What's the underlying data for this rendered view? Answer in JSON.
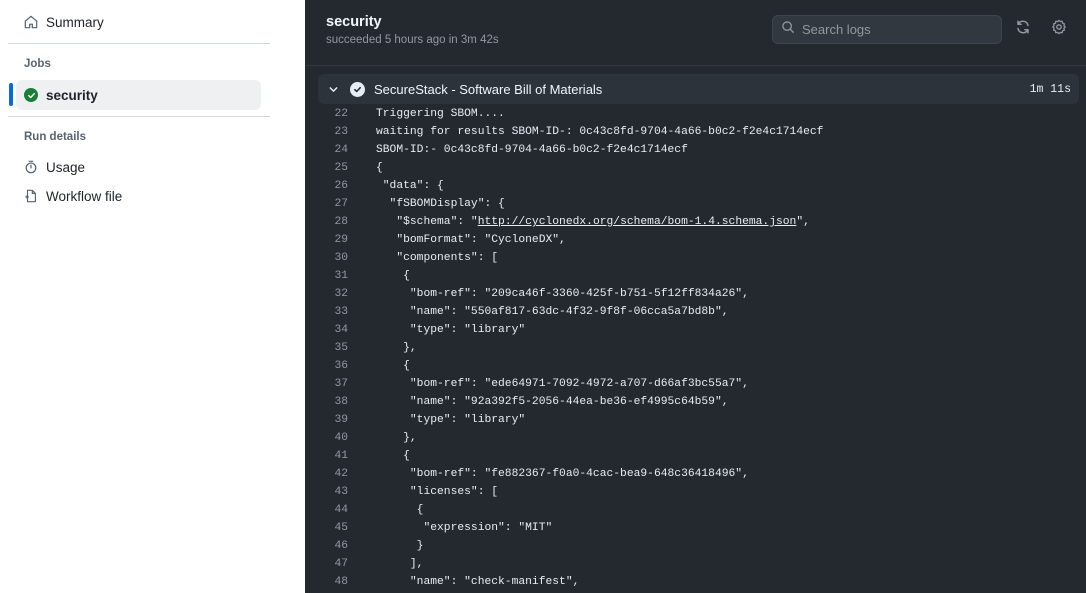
{
  "sidebar": {
    "summary_label": "Summary",
    "jobs_heading": "Jobs",
    "job_label": "security",
    "run_details_heading": "Run details",
    "usage_label": "Usage",
    "workflow_label": "Workflow file"
  },
  "header": {
    "title": "security",
    "subtitle": "succeeded 5 hours ago in 3m 42s",
    "search_placeholder": "Search logs"
  },
  "step": {
    "name": "SecureStack - Software Bill of Materials",
    "duration": "1m 11s"
  },
  "log_lines": [
    {
      "n": "22",
      "t": "Triggering SBOM...."
    },
    {
      "n": "23",
      "t": "waiting for results SBOM-ID-: 0c43c8fd-9704-4a66-b0c2-f2e4c1714ecf"
    },
    {
      "n": "24",
      "t": "SBOM-ID:- 0c43c8fd-9704-4a66-b0c2-f2e4c1714ecf"
    },
    {
      "n": "25",
      "t": "{"
    },
    {
      "n": "26",
      "t": " \"data\": {"
    },
    {
      "n": "27",
      "t": "  \"fSBOMDisplay\": {"
    },
    {
      "n": "28",
      "pre": "   \"$schema\": \"",
      "link": "http://cyclonedx.org/schema/bom-1.4.schema.json",
      "post": "\","
    },
    {
      "n": "29",
      "t": "   \"bomFormat\": \"CycloneDX\","
    },
    {
      "n": "30",
      "t": "   \"components\": ["
    },
    {
      "n": "31",
      "t": "    {"
    },
    {
      "n": "32",
      "t": "     \"bom-ref\": \"209ca46f-3360-425f-b751-5f12ff834a26\","
    },
    {
      "n": "33",
      "t": "     \"name\": \"550af817-63dc-4f32-9f8f-06cca5a7bd8b\","
    },
    {
      "n": "34",
      "t": "     \"type\": \"library\""
    },
    {
      "n": "35",
      "t": "    },"
    },
    {
      "n": "36",
      "t": "    {"
    },
    {
      "n": "37",
      "t": "     \"bom-ref\": \"ede64971-7092-4972-a707-d66af3bc55a7\","
    },
    {
      "n": "38",
      "t": "     \"name\": \"92a392f5-2056-44ea-be36-ef4995c64b59\","
    },
    {
      "n": "39",
      "t": "     \"type\": \"library\""
    },
    {
      "n": "40",
      "t": "    },"
    },
    {
      "n": "41",
      "t": "    {"
    },
    {
      "n": "42",
      "t": "     \"bom-ref\": \"fe882367-f0a0-4cac-bea9-648c36418496\","
    },
    {
      "n": "43",
      "t": "     \"licenses\": ["
    },
    {
      "n": "44",
      "t": "      {"
    },
    {
      "n": "45",
      "t": "       \"expression\": \"MIT\""
    },
    {
      "n": "46",
      "t": "      }"
    },
    {
      "n": "47",
      "t": "     ],"
    },
    {
      "n": "48",
      "t": "     \"name\": \"check-manifest\","
    }
  ],
  "colors": {
    "accent": "#0969da",
    "success": "#1a7f37",
    "log_bg": "#24292f"
  },
  "icons": [
    "home-icon",
    "check-circle-icon",
    "stopwatch-icon",
    "workflow-file-icon",
    "search-icon",
    "refresh-icon",
    "gear-icon",
    "chevron-down-icon"
  ]
}
